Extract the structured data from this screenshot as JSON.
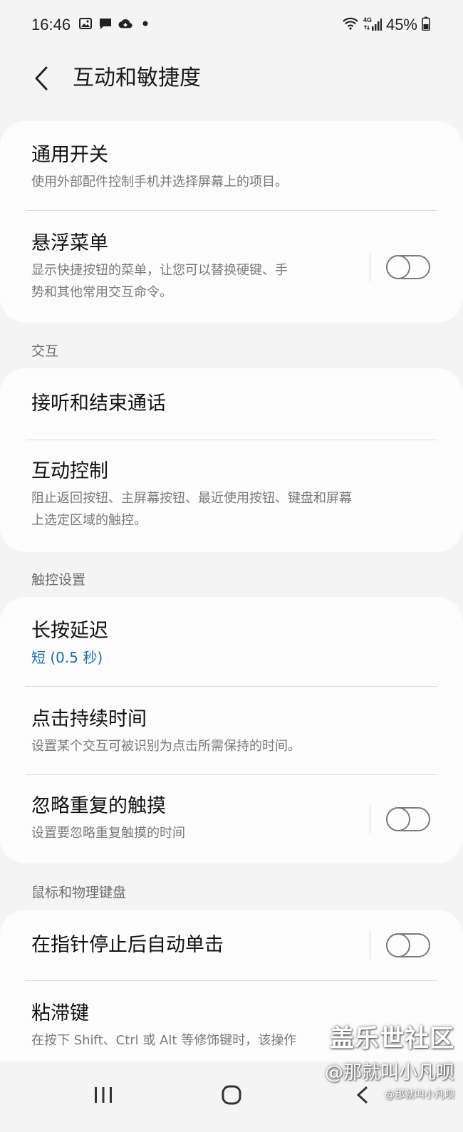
{
  "status_bar": {
    "time": "16:46",
    "battery": "45%",
    "network": "4G"
  },
  "header": {
    "title": "互动和敏捷度"
  },
  "cards": {
    "top": {
      "universal_switch": {
        "title": "通用开关",
        "subtitle": "使用外部配件控制手机并选择屏幕上的项目。"
      },
      "assistant_menu": {
        "title": "悬浮菜单",
        "subtitle_line1": "显示快捷按钮的菜单，让您可以替换硬键、手",
        "subtitle_line2": "势和其他常用交互命令。",
        "toggle": false
      }
    },
    "interaction": {
      "section_title": "交互",
      "answer_end_calls": {
        "title": "接听和结束通话"
      },
      "interaction_control": {
        "title": "互动控制",
        "subtitle_line1": "阻止返回按钮、主屏幕按钮、最近使用按钮、键盘和屏幕",
        "subtitle_line2": "上选定区域的触控。"
      }
    },
    "touch_settings": {
      "section_title": "触控设置",
      "touch_hold_delay": {
        "title": "长按延迟",
        "value": "短 (0.5 秒)"
      },
      "tap_duration": {
        "title": "点击持续时间",
        "subtitle": "设置某个交互可被识别为点击所需保持的时间。"
      },
      "ignore_repeated_touches": {
        "title": "忽略重复的触摸",
        "subtitle": "设置要忽略重复触摸的时间",
        "toggle": false
      }
    },
    "mouse_keyboard": {
      "section_title": "鼠标和物理键盘",
      "auto_click": {
        "title": "在指针停止后自动单击",
        "toggle": false
      },
      "sticky_keys": {
        "title": "粘滞键",
        "subtitle": "在按下 Shift、Ctrl 或 Alt 等修饰键时，该操作"
      }
    }
  },
  "watermark": {
    "main": "盖乐世社区",
    "sub": "@那就叫小凡呗",
    "small": "@那就叫小凡呗"
  },
  "colors": {
    "background": "#f4f4f4",
    "card": "#fcfcfc",
    "value_accent": "#1c6fa8"
  }
}
